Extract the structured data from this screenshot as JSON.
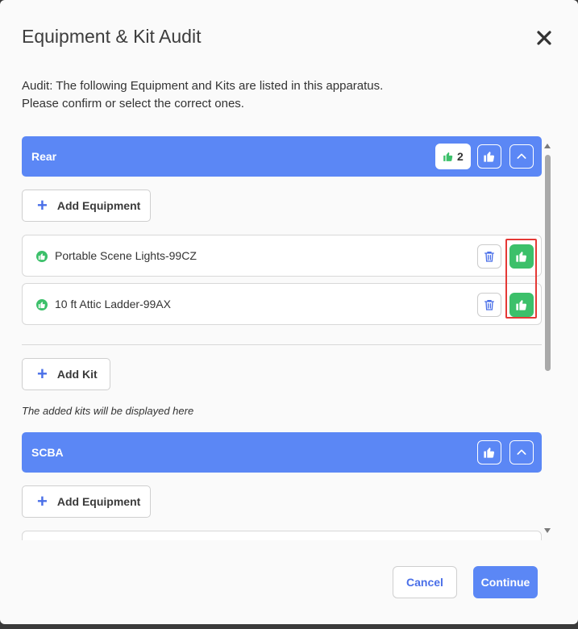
{
  "modal": {
    "title": "Equipment & Kit Audit",
    "intro_line1": "Audit: The following Equipment and Kits are listed in this apparatus.",
    "intro_line2": "Please confirm or select the correct ones."
  },
  "sections": [
    {
      "name": "Rear",
      "confirmed_count": "2",
      "add_equipment_label": "Add Equipment",
      "items": [
        {
          "label": "Portable Scene Lights-99CZ",
          "status": "confirmed"
        },
        {
          "label": "10 ft Attic Ladder-99AX",
          "status": "confirmed"
        }
      ],
      "add_kit_label": "Add Kit",
      "kits_hint": "The added kits will be displayed here"
    },
    {
      "name": "SCBA",
      "add_equipment_label": "Add Equipment"
    }
  ],
  "footer": {
    "cancel_label": "Cancel",
    "continue_label": "Continue"
  },
  "colors": {
    "accent": "#5b87f5",
    "confirm": "#3cc06a",
    "highlight": "#e53935"
  },
  "icons": [
    "close-icon",
    "thumbs-up-icon",
    "chevron-up-icon",
    "plus-icon",
    "trash-icon",
    "check-circle-icon"
  ]
}
